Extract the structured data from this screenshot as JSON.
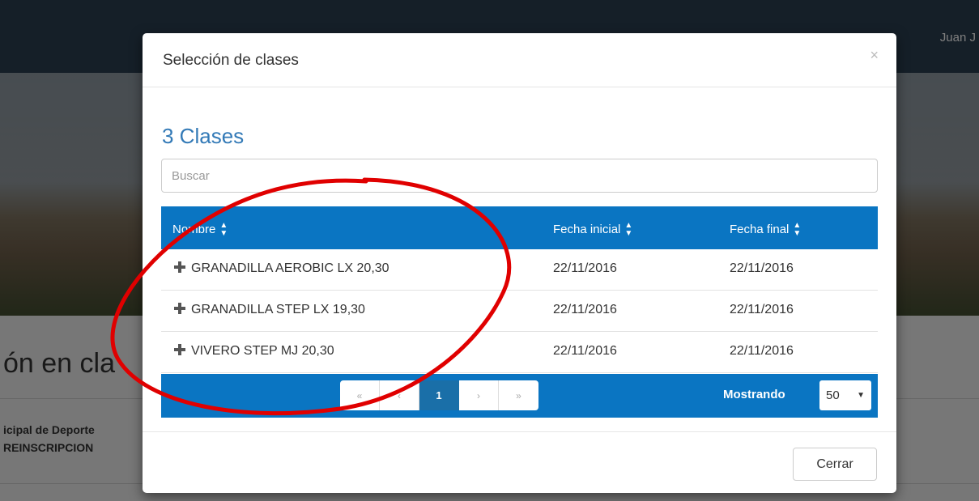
{
  "navbar": {
    "user_name": "Juan J"
  },
  "background": {
    "heading_fragment": "ón en cla",
    "line1_fragment": "icipal de Deporte",
    "line2_fragment": "REINSCRIPCION"
  },
  "modal": {
    "title": "Selección de clases",
    "close_glyph": "×",
    "count_label": "3 Clases",
    "search_placeholder": "Buscar",
    "columns": {
      "name": "Nombre",
      "start": "Fecha inicial",
      "end": "Fecha final"
    },
    "rows": [
      {
        "name": "GRANADILLA AEROBIC LX 20,30",
        "start": "22/11/2016",
        "end": "22/11/2016"
      },
      {
        "name": "GRANADILLA STEP LX 19,30",
        "start": "22/11/2016",
        "end": "22/11/2016"
      },
      {
        "name": "VIVERO STEP MJ 20,30",
        "start": "22/11/2016",
        "end": "22/11/2016"
      }
    ],
    "pagination": {
      "first": "«",
      "prev": "‹",
      "current": "1",
      "next": "›",
      "last": "»"
    },
    "showing": {
      "label": "Mostrando",
      "value": "50"
    },
    "close_button_label": "Cerrar"
  },
  "icons": {
    "sort": "sort-icon",
    "expand": "plus-icon",
    "dropdown": "caret-icon",
    "close": "close-icon"
  },
  "colors": {
    "header_blue": "#0a75c2",
    "accent": "#337ab7",
    "annotation": "#e00000"
  }
}
